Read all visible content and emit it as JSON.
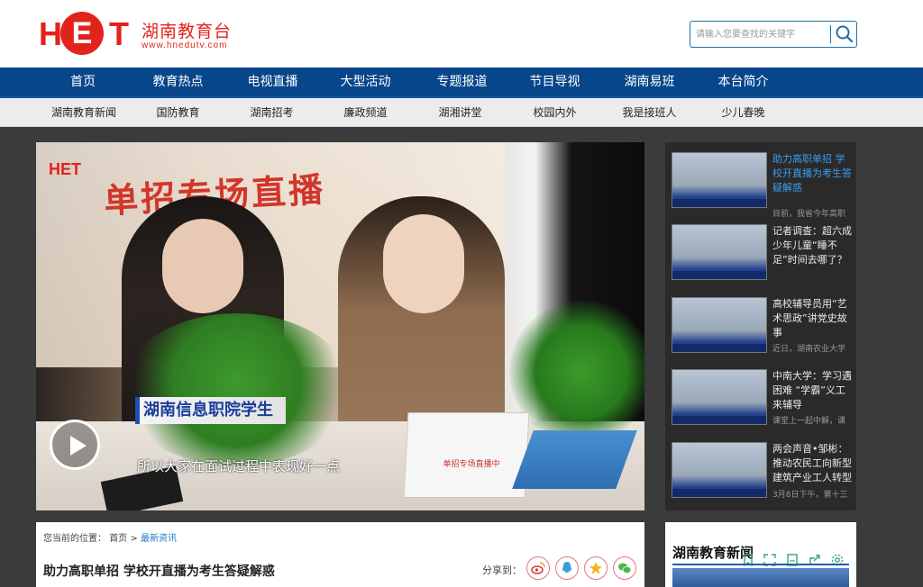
{
  "brand": {
    "logo_letters": [
      "H",
      "E",
      "T"
    ],
    "name": "湖南教育台",
    "url": "www.hnedutv.com",
    "color": "#e3221c"
  },
  "search": {
    "placeholder": "请输入您要查找的关键字",
    "icon": "search-icon"
  },
  "main_nav": {
    "items": [
      "首页",
      "教育热点",
      "电视直播",
      "大型活动",
      "专题报道",
      "节目导视",
      "湖南易班",
      "本台简介"
    ],
    "background": "#07468a"
  },
  "sub_nav": {
    "items": [
      "湖南教育新闻",
      "国防教育",
      "湖南招考",
      "廉政频道",
      "湖湘讲堂",
      "校园内外",
      "我是接班人",
      "少儿春晚"
    ]
  },
  "hero": {
    "logo_text": "HET",
    "banner": "单招专场直播",
    "name_caption": "湖南信息职院学生",
    "subtitle": "所以大家在面试过程中表现好一点",
    "tent_card": "单招专场直播中",
    "play_icon": "play-icon"
  },
  "side_news": [
    {
      "title": "助力高职单招 学校开直播为考生答疑解惑",
      "desc": "目前，我省今年高职",
      "active": true
    },
    {
      "title": "记者调查：超六成少年儿童“睡不足”时间去哪了？",
      "desc": "",
      "active": false
    },
    {
      "title": "高校辅导员用“艺术思政”讲党史故事",
      "desc": "近日，湖南农业大学",
      "active": false
    },
    {
      "title": "中南大学：学习遇困难 “学霸”义工来辅导",
      "desc": "课堂上一起中解，课",
      "active": false
    },
    {
      "title": "两会声音•邹彬：推动农民工向新型建筑产业工人转型",
      "desc": "3月8日下午，第十三",
      "active": false
    }
  ],
  "breadcrumb": {
    "prefix": "您当前的位置：",
    "home": "首页",
    "separator": ">",
    "current": "最新资讯"
  },
  "article": {
    "title": "助力高职单招 学校开直播为考生答疑解惑",
    "share_label": "分享到：",
    "share_icons": [
      "weibo-icon",
      "qq-icon",
      "qzone-icon",
      "wechat-icon"
    ]
  },
  "news_panel": {
    "heading": "湖南教育新闻",
    "toolbar_icons": [
      "bookmark-icon",
      "expand-icon",
      "save-icon",
      "share-icon",
      "settings-icon"
    ]
  }
}
